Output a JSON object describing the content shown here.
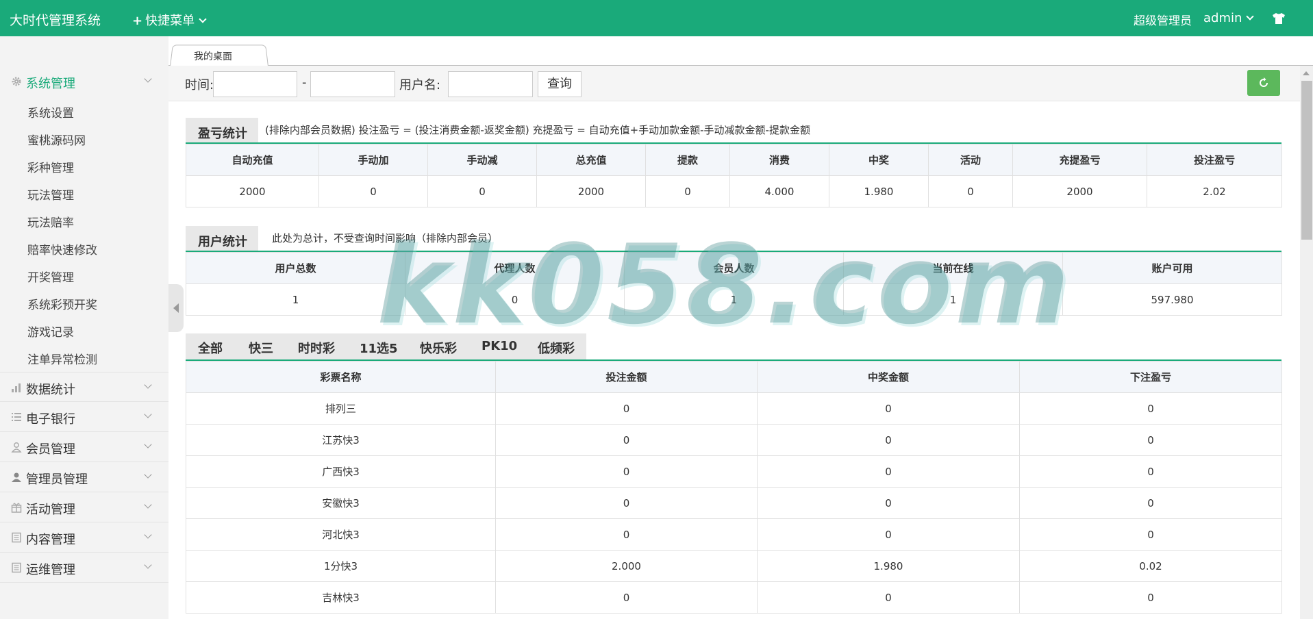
{
  "header": {
    "brand": "大时代管理系统",
    "quick_menu": "快捷菜单",
    "role": "超级管理员",
    "username": "admin"
  },
  "sidebar": {
    "groups": [
      {
        "label": "系统管理",
        "icon": "gear-icon",
        "active": true
      },
      {
        "label": "数据统计",
        "icon": "bar-chart-icon"
      },
      {
        "label": "电子银行",
        "icon": "list-icon"
      },
      {
        "label": "会员管理",
        "icon": "user-outline-icon"
      },
      {
        "label": "管理员管理",
        "icon": "user-icon"
      },
      {
        "label": "活动管理",
        "icon": "gift-icon"
      },
      {
        "label": "内容管理",
        "icon": "document-icon"
      },
      {
        "label": "运维管理",
        "icon": "document-icon"
      }
    ],
    "sub_items": [
      "系统设置",
      "蜜桃源码网",
      "彩种管理",
      "玩法管理",
      "玩法赔率",
      "赔率快速修改",
      "开奖管理",
      "系统彩预开奖",
      "游戏记录",
      "注单异常检测"
    ]
  },
  "tabs": {
    "desk": "我的桌面"
  },
  "search": {
    "time_label": "时间:",
    "dash": "-",
    "username_label": "用户名:",
    "query_button": "查询"
  },
  "profit_stats": {
    "title": "盈亏统计",
    "note": "(排除内部会员数据)  投注盈亏 = (投注消费金额-返奖金额)    充提盈亏 = 自动充值+手动加款金额-手动减款金额-提款金额",
    "headers": [
      "自动充值",
      "手动加",
      "手动减",
      "总充值",
      "提款",
      "消费",
      "中奖",
      "活动",
      "充提盈亏",
      "投注盈亏"
    ],
    "values": [
      "2000",
      "0",
      "0",
      "2000",
      "0",
      "4.000",
      "1.980",
      "0",
      "2000",
      "2.02"
    ]
  },
  "user_stats": {
    "title": "用户统计",
    "note": "此处为总计，不受查询时间影响（排除内部会员）",
    "headers": [
      "用户总数",
      "代理人数",
      "会员人数",
      "当前在线",
      "账户可用"
    ],
    "values": [
      "1",
      "0",
      "1",
      "1",
      "597.980"
    ]
  },
  "lottery": {
    "categories": [
      "全部",
      "快三",
      "时时彩",
      "11选5",
      "快乐彩",
      "PK10",
      "低频彩"
    ],
    "headers": [
      "彩票名称",
      "投注金额",
      "中奖金额",
      "下注盈亏"
    ],
    "rows": [
      [
        "排列三",
        "0",
        "0",
        "0"
      ],
      [
        "江苏快3",
        "0",
        "0",
        "0"
      ],
      [
        "广西快3",
        "0",
        "0",
        "0"
      ],
      [
        "安徽快3",
        "0",
        "0",
        "0"
      ],
      [
        "河北快3",
        "0",
        "0",
        "0"
      ],
      [
        "1分快3",
        "2.000",
        "1.980",
        "0.02"
      ],
      [
        "吉林快3",
        "0",
        "0",
        "0"
      ]
    ]
  },
  "watermark": "kk058.com",
  "colors": {
    "brand_green": "#1aaa7a",
    "refresh_green": "#5cb85c"
  }
}
